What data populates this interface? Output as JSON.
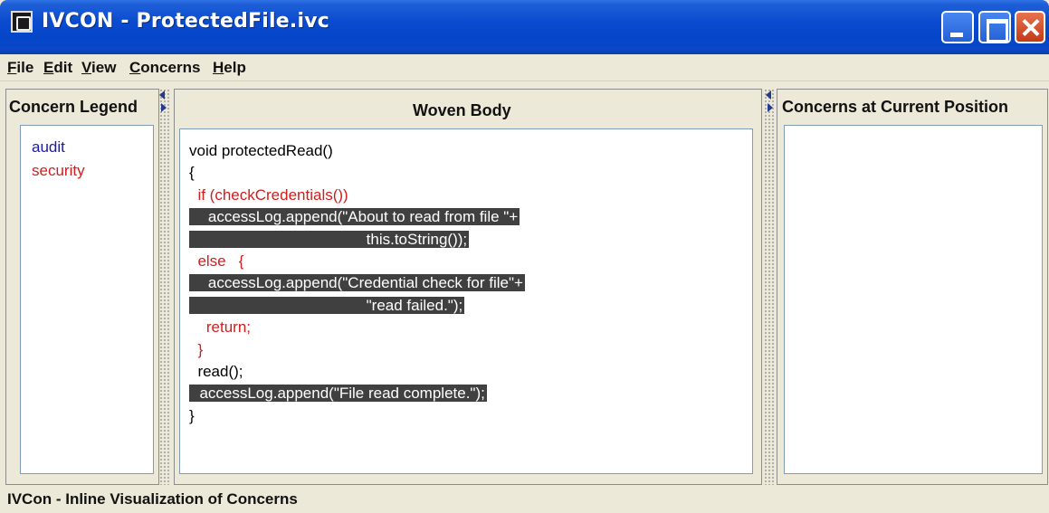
{
  "window": {
    "title": "IVCON - ProtectedFile.ivc",
    "app_icon": "ivcon-app-icon"
  },
  "menu": {
    "items": [
      {
        "label": "File",
        "mnemonic": "F",
        "rest": "ile"
      },
      {
        "label": "Edit",
        "mnemonic": "E",
        "rest": "dit"
      },
      {
        "label": "View",
        "mnemonic": "V",
        "rest": "iew"
      },
      {
        "label": "Concerns",
        "mnemonic": "C",
        "rest": "oncerns"
      },
      {
        "label": "Help",
        "mnemonic": "H",
        "rest": "elp"
      }
    ]
  },
  "legend": {
    "header": "Concern Legend",
    "items": [
      {
        "label": "audit",
        "color": "#1a1aa6"
      },
      {
        "label": "security",
        "color": "#d21d1d"
      }
    ]
  },
  "woven": {
    "header": "Woven Body",
    "lines": [
      {
        "text": "void protectedRead()",
        "style": "plain"
      },
      {
        "text": "{",
        "style": "plain"
      },
      {
        "text": "  if (checkCredentials())",
        "style": "red"
      },
      {
        "text": "    accessLog.append(\"About to read from file \"+",
        "style": "hl"
      },
      {
        "text": "                                         this.toString());",
        "style": "hl"
      },
      {
        "text": "  else   {",
        "style": "red"
      },
      {
        "text": "    accessLog.append(\"Credential check for file\"+",
        "style": "hl"
      },
      {
        "text": "                                         \"read failed.\");",
        "style": "hl"
      },
      {
        "text": "    return;",
        "style": "red"
      },
      {
        "text": "  }",
        "style": "red"
      },
      {
        "text": "  read();",
        "style": "plain"
      },
      {
        "text": "  accessLog.append(\"File read complete.\");",
        "style": "hl"
      },
      {
        "text": "}",
        "style": "plain"
      }
    ]
  },
  "current": {
    "header": "Concerns at Current Position"
  },
  "status": {
    "text": "IVCon - Inline Visualization of Concerns"
  },
  "colors": {
    "highlight_bg": "#404040",
    "security_red": "#d21d1d",
    "audit_blue": "#1a1aa6"
  }
}
